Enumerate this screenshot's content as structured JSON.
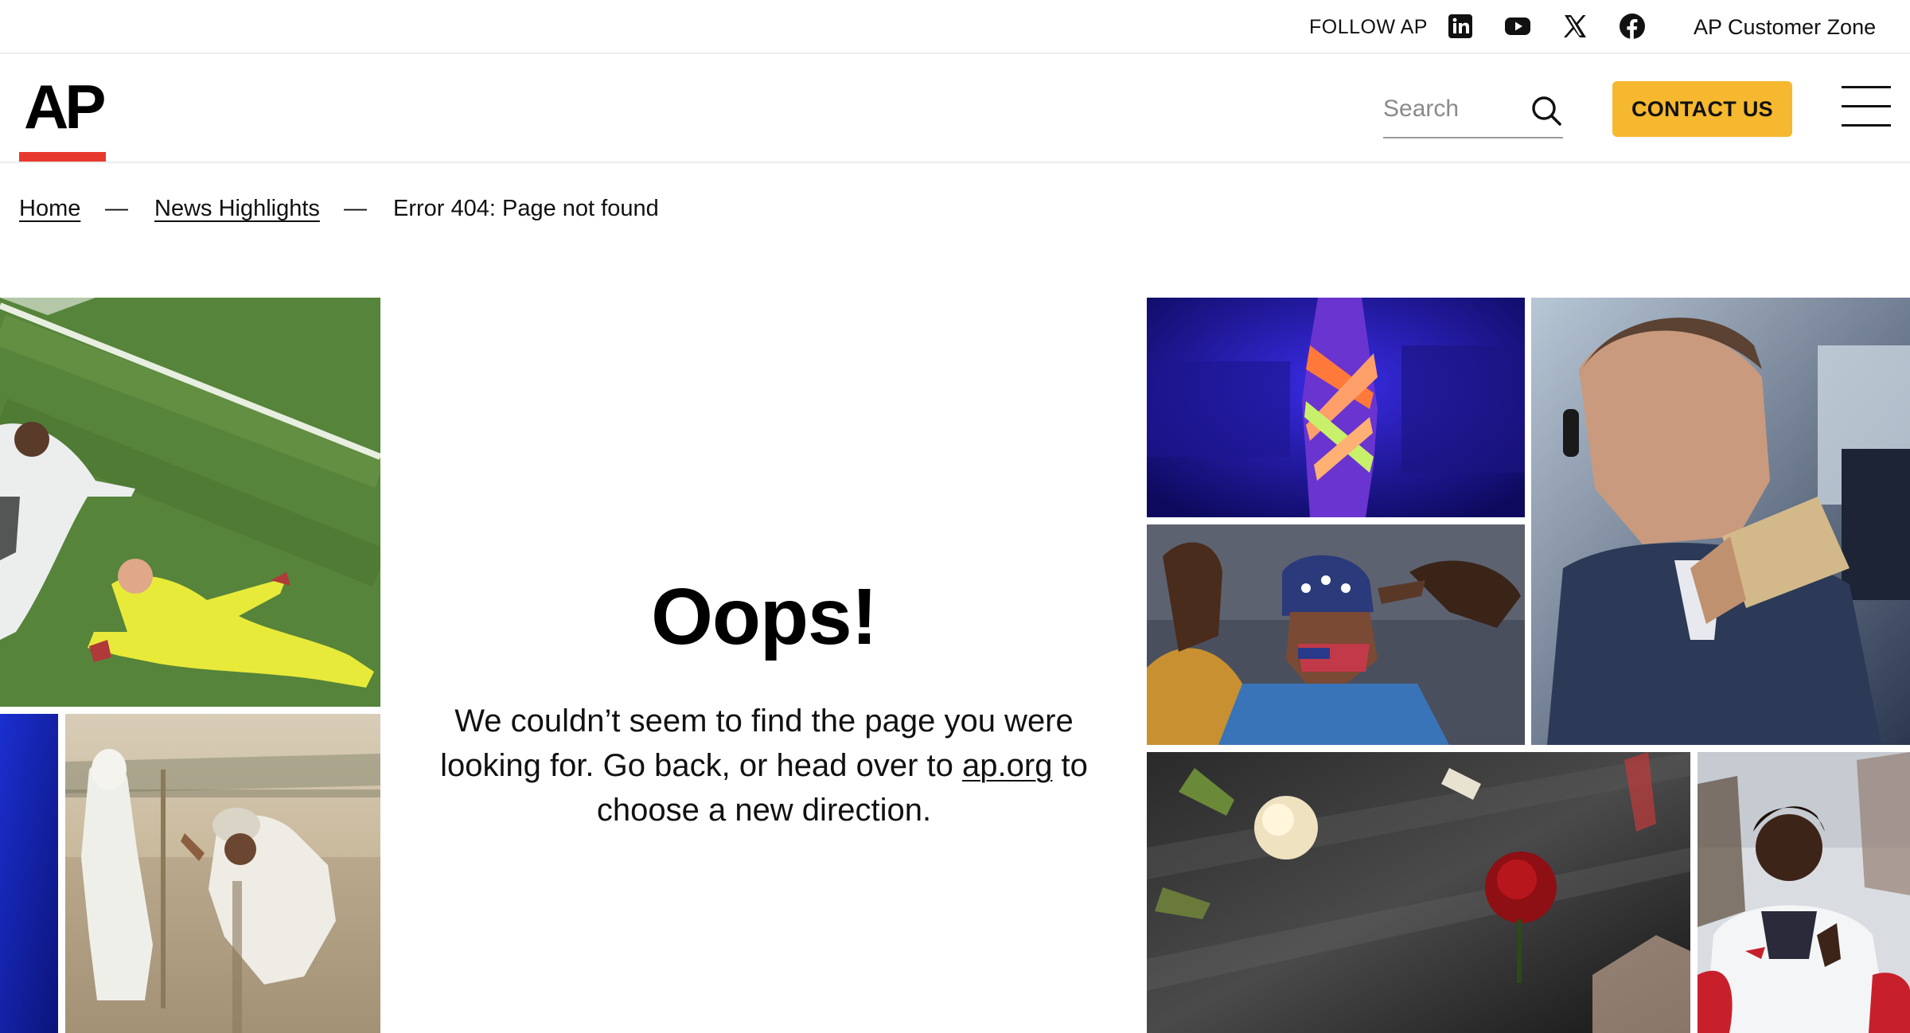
{
  "topbar": {
    "follow_label": "FOLLOW AP",
    "social_icons": [
      "linkedin-icon",
      "youtube-icon",
      "x-icon",
      "facebook-icon"
    ],
    "customer_zone": "AP Customer Zone"
  },
  "header": {
    "logo_text": "AP",
    "search_placeholder": "Search",
    "contact_label": "CONTACT US"
  },
  "breadcrumb": {
    "items": [
      "Home",
      "News Highlights",
      "Error 404: Page not found"
    ],
    "separator": "—"
  },
  "main": {
    "heading": "Oops!",
    "message_before": "We couldn’t seem to find the page you were looking for. Go back, or head over to ",
    "message_link": "ap.org",
    "message_after": " to choose a new direction."
  },
  "colors": {
    "accent_red": "#e8392f",
    "contact_yellow": "#f5b82e"
  }
}
